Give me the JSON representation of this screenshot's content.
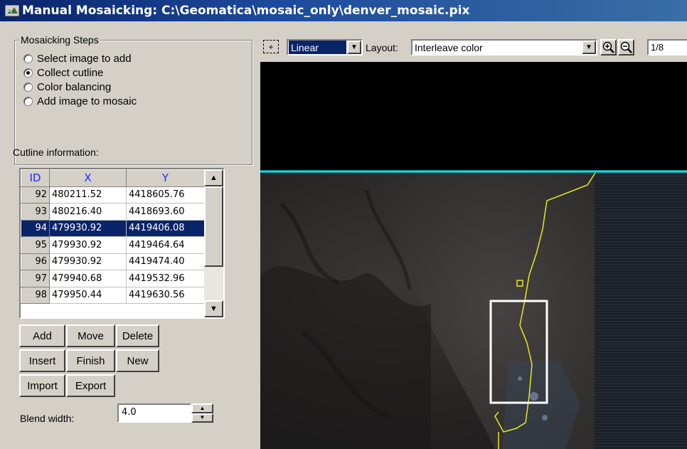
{
  "window": {
    "title": "Manual Mosaicking: C:\\Geomatica\\mosaic_only\\denver_mosaic.pix"
  },
  "steps": {
    "group_label": "Mosaicking Steps",
    "options": [
      {
        "label": "Select image to add",
        "checked": false
      },
      {
        "label": "Collect cutline",
        "checked": true
      },
      {
        "label": "Color balancing",
        "checked": false
      },
      {
        "label": "Add image to mosaic",
        "checked": false
      }
    ]
  },
  "cutline": {
    "label": "Cutline information:",
    "headers": {
      "id": "ID",
      "x": "X",
      "y": "Y"
    },
    "rows": [
      {
        "id": "92",
        "x": "480211.52",
        "y": "4418605.76"
      },
      {
        "id": "93",
        "x": "480216.40",
        "y": "4418693.60"
      },
      {
        "id": "94",
        "x": "479930.92",
        "y": "4419406.08"
      },
      {
        "id": "95",
        "x": "479930.92",
        "y": "4419464.64"
      },
      {
        "id": "96",
        "x": "479930.92",
        "y": "4419474.40"
      },
      {
        "id": "97",
        "x": "479940.68",
        "y": "4419532.96"
      },
      {
        "id": "98",
        "x": "479950.44",
        "y": "4419630.56"
      }
    ],
    "selected_id": "94"
  },
  "buttons": {
    "add": "Add",
    "move": "Move",
    "delete": "Delete",
    "insert": "Insert",
    "finish": "Finish",
    "new": "New",
    "import": "Import",
    "export": "Export"
  },
  "blend": {
    "label": "Blend width:",
    "value": "4.0"
  },
  "viewer": {
    "stretch": "Linear",
    "layout_label": "Layout:",
    "layout": "Interleave color",
    "zoom": "1/8"
  },
  "colors": {
    "selection": "#0a246a",
    "header_text": "#1a2cff",
    "cutline": "#e8e822",
    "boundary": "#00e5f0"
  }
}
